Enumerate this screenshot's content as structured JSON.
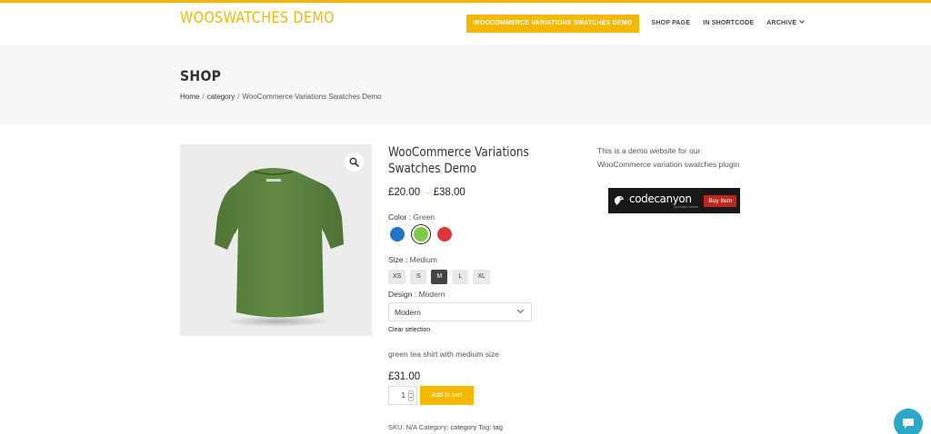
{
  "header": {
    "site_title": "WOOSWATCHES DEMO",
    "nav": [
      {
        "label": "WOOCOMMERCE VARIATIONS SWATCHES DEMO",
        "active": true
      },
      {
        "label": "SHOP PAGE",
        "active": false
      },
      {
        "label": "IN SHORTCODE",
        "active": false
      },
      {
        "label": "ARCHIVE",
        "active": false,
        "has_dropdown": true
      }
    ]
  },
  "banner": {
    "title": "SHOP",
    "breadcrumb": [
      "Home",
      "category",
      "WooCommerce Variations Swatches Demo"
    ],
    "separator": "/"
  },
  "product": {
    "image_icon": "green-tshirt-back-icon",
    "zoom_icon": "magnifier-icon",
    "title": "WooCommerce Variations Swatches Demo",
    "price_min": "£20.00",
    "price_sep": "–",
    "price_max": "£38.00",
    "color": {
      "label": "Color",
      "selected": "Green",
      "options": [
        {
          "name": "Blue",
          "hex": "#1f74c9",
          "selected": false
        },
        {
          "name": "Green",
          "hex": "#7fcb46",
          "selected": true
        },
        {
          "name": "Red",
          "hex": "#e0343a",
          "selected": false
        }
      ]
    },
    "size": {
      "label": "Size",
      "selected": "Medium",
      "options": [
        {
          "label": "XS",
          "selected": false
        },
        {
          "label": "S",
          "selected": false
        },
        {
          "label": "M",
          "selected": true
        },
        {
          "label": "L",
          "selected": false
        },
        {
          "label": "XL",
          "selected": false
        }
      ]
    },
    "design": {
      "label": "Design",
      "selected": "Modern",
      "select_value": "Modern"
    },
    "clear_selection": "Clear selection",
    "variation_description": "green tea shirt with medium size",
    "variation_price": "£31.00",
    "quantity": "1",
    "add_to_cart": "Add to cart",
    "meta": {
      "sku_label": "SKU:",
      "sku_value": "N/A",
      "category_label": "Category:",
      "category_value": "category",
      "tag_label": "Tag:",
      "tag_value": "tag"
    }
  },
  "sidebar": {
    "text": "This is a demo website for our WooCommerce variation swatches  plugin",
    "banner": {
      "logo_icon": "codecanyon-logo-icon",
      "logo_text": "codecanyon",
      "sub_text": "by envato market",
      "button": "Buy Item"
    }
  },
  "chat": {
    "icon": "chat-bubble-icon"
  },
  "colors": {
    "accent": "#f5b800",
    "banner_bg": "#f7f7f7",
    "shirt": "#5c8640",
    "buy_button": "#c3271c",
    "chat": "#2ba7c7"
  }
}
